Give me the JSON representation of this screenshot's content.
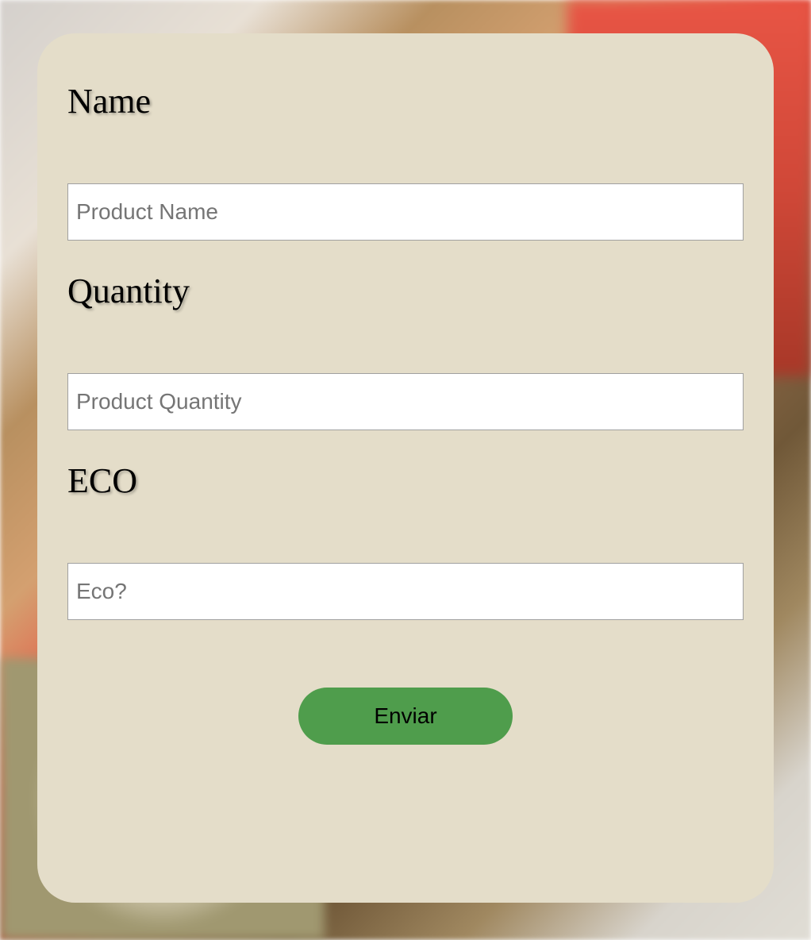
{
  "form": {
    "fields": {
      "name": {
        "label": "Name",
        "placeholder": "Product Name",
        "value": ""
      },
      "quantity": {
        "label": "Quantity",
        "placeholder": "Product Quantity",
        "value": ""
      },
      "eco": {
        "label": "ECO",
        "placeholder": "Eco?",
        "value": ""
      }
    },
    "submit_label": "Enviar"
  }
}
